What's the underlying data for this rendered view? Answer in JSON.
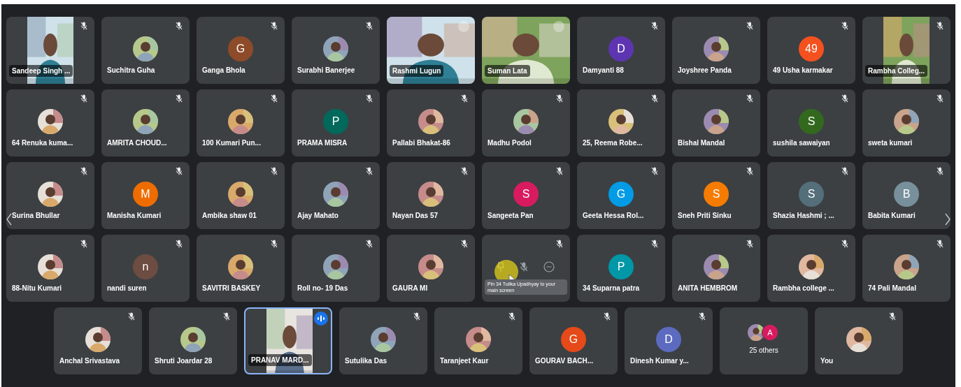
{
  "rows": [
    {
      "tiles": [
        {
          "kind": "portrait",
          "name": "Sandeep Singh ...",
          "muted": true,
          "speaking": false
        },
        {
          "name": "Suchitra Guha",
          "muted": true,
          "speaking": false
        },
        {
          "kind": "letter",
          "name": "Ganga Bhola",
          "letter": "G",
          "color": "#8d4b2a",
          "muted": true,
          "speaking": false
        },
        {
          "name": "Surabhi Banerjee",
          "muted": true,
          "speaking": false
        },
        {
          "kind": "video",
          "name": "Rashmi Lugun",
          "muted": false,
          "speaking": false
        },
        {
          "kind": "video",
          "name": "Suman Lata",
          "muted": false,
          "speaking": false
        },
        {
          "kind": "letter",
          "name": "Damyanti 88",
          "letter": "D",
          "color": "#5e35b1",
          "muted": true,
          "speaking": false
        },
        {
          "name": "Joyshree Panda",
          "muted": true,
          "speaking": false
        },
        {
          "kind": "letter",
          "name": "49 Usha karmakar",
          "letter": "49",
          "color": "#f4511e",
          "muted": true,
          "speaking": false
        },
        {
          "kind": "portrait",
          "name": "Rambha Colleg...",
          "muted": true,
          "speaking": false
        }
      ]
    },
    {
      "tiles": [
        {
          "name": "64 Renuka kuma...",
          "muted": true,
          "speaking": false
        },
        {
          "name": "AMRITA CHOUD...",
          "muted": true,
          "speaking": false
        },
        {
          "name": "100 Kumari Pun...",
          "muted": true,
          "speaking": false
        },
        {
          "kind": "letter",
          "name": "PRAMA MISRA",
          "letter": "P",
          "color": "#00695c",
          "muted": true,
          "speaking": false
        },
        {
          "name": "Pallabi Bhakat-86",
          "muted": true,
          "speaking": false
        },
        {
          "name": "Madhu Podol",
          "muted": true,
          "speaking": false
        },
        {
          "name": "25, Reema Robe...",
          "muted": true,
          "speaking": false
        },
        {
          "name": "Bishal Mandal",
          "muted": true,
          "speaking": false
        },
        {
          "kind": "letter",
          "name": "sushila sawaiyan",
          "letter": "S",
          "color": "#33691e",
          "muted": true,
          "speaking": false
        },
        {
          "name": "sweta kumari",
          "muted": true,
          "speaking": false
        }
      ]
    },
    {
      "tiles": [
        {
          "name": "Surina Bhullar",
          "muted": true,
          "speaking": false
        },
        {
          "kind": "letter",
          "name": "Manisha Kumari",
          "letter": "M",
          "color": "#ef6c00",
          "muted": true,
          "speaking": false
        },
        {
          "name": "Ambika shaw 01",
          "muted": true,
          "speaking": false
        },
        {
          "name": "Ajay Mahato",
          "muted": true,
          "speaking": false
        },
        {
          "name": "Nayan Das 57",
          "muted": true,
          "speaking": false
        },
        {
          "kind": "letter",
          "name": "Sangeeta Pan",
          "letter": "S",
          "color": "#d81b60",
          "muted": true,
          "speaking": false
        },
        {
          "kind": "letter",
          "name": "Geeta Hessa Rol...",
          "letter": "G",
          "color": "#039be5",
          "muted": true,
          "speaking": false
        },
        {
          "kind": "letter",
          "name": "Sneh Priti Sinku",
          "letter": "S",
          "color": "#f57c00",
          "muted": true,
          "speaking": false
        },
        {
          "kind": "letter",
          "name": "Shazia Hashmi ; ...",
          "letter": "S",
          "color": "#546e7a",
          "muted": true,
          "speaking": false
        },
        {
          "kind": "letter",
          "name": "Babita Kumari",
          "letter": "B",
          "color": "#78909c",
          "muted": true,
          "speaking": false
        }
      ]
    },
    {
      "tiles": [
        {
          "name": "88-Nitu Kumari",
          "muted": true,
          "speaking": false
        },
        {
          "kind": "letter",
          "name": "nandi suren",
          "letter": "n",
          "color": "#6d4c41",
          "muted": true,
          "speaking": false
        },
        {
          "name": "SAVITRI BASKEY",
          "muted": true,
          "speaking": false
        },
        {
          "name": "Roll no- 19 Das",
          "muted": true,
          "speaking": false
        },
        {
          "name": "GAURA MI",
          "muted": true,
          "speaking": false
        },
        {
          "kind": "hover",
          "tooltip": "Pin 34 Tulika Upadhyay to your main screen",
          "muted": true,
          "speaking": false
        },
        {
          "kind": "letter",
          "name": "34 Suparna patra",
          "letter": "P",
          "color": "#0097a7",
          "muted": true,
          "speaking": false
        },
        {
          "name": "ANITA HEMBROM",
          "muted": true,
          "speaking": false
        },
        {
          "name": "Rambha college ...",
          "muted": true,
          "speaking": false
        },
        {
          "name": "74 Pali Mandal",
          "muted": true,
          "speaking": false
        }
      ]
    },
    {
      "tiles": [
        {
          "name": "Anchal Srivastava",
          "muted": true,
          "speaking": false
        },
        {
          "name": "Shruti Joardar 28",
          "muted": true,
          "speaking": false
        },
        {
          "kind": "portrait",
          "name": "PRANAV MARD...",
          "muted": false,
          "speaking": true
        },
        {
          "name": "Sutulika Das",
          "muted": true,
          "speaking": false
        },
        {
          "name": "Taranjeet Kaur",
          "muted": true,
          "speaking": false
        },
        {
          "kind": "letter",
          "name": "GOURAV BACH...",
          "letter": "G",
          "color": "#e64a19",
          "muted": true,
          "speaking": false
        },
        {
          "kind": "letter",
          "name": "Dinesh Kumar y...",
          "letter": "D",
          "color": "#5c6bc0",
          "muted": true,
          "speaking": false
        },
        {
          "kind": "others",
          "label": "25 others",
          "letter": "A",
          "color": "#d81b60"
        },
        {
          "name": "You",
          "muted": true,
          "speaking": false
        }
      ]
    }
  ]
}
